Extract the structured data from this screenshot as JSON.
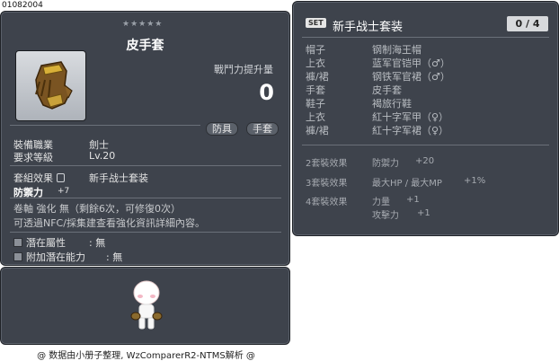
{
  "item_id": "01082004",
  "tooltip": {
    "stars": "★★★★★",
    "title": "皮手套",
    "attack_increase_label": "戰鬥力提升量",
    "attack_increase_value": "0",
    "tags": [
      "防具",
      "手套"
    ],
    "req_job_label": "裝備職業",
    "req_job_value": "劍士",
    "req_level_label": "要求等級",
    "req_level_value": "Lv.20",
    "set_effect_label": "套組效果",
    "set_effect_value": "新手战士套装",
    "stat_label": "防禦力",
    "stat_value": "+7",
    "upgrade_text": "卷軸 強化 無（剩餘6次，可修復0次）",
    "enhance_text": "可透過NFC/採集建查看強化資訊詳細內容。",
    "potential_label": "潛在屬性",
    "potential_value": ": 無",
    "additional_potential_label": "附加潛在能力",
    "additional_potential_value": ": 無"
  },
  "set_panel": {
    "badge": "SET",
    "name": "新手战士套装",
    "count": "0 / 4",
    "items": [
      {
        "slot": "帽子",
        "name": "钢制海王帽"
      },
      {
        "slot": "上衣",
        "name": "蓝军官铠甲（♂）"
      },
      {
        "slot": "褲/裙",
        "name": "钢铁军官裙（♂）"
      },
      {
        "slot": "手套",
        "name": "皮手套"
      },
      {
        "slot": "鞋子",
        "name": "褐旅行鞋"
      },
      {
        "slot": "上衣",
        "name": "紅十字军甲（♀）"
      },
      {
        "slot": "褲/裙",
        "name": "紅十字军裙（♀）"
      }
    ],
    "effects": [
      {
        "label": "2套裝效果",
        "lines": [
          {
            "stat": "防禦力",
            "value": "+20"
          }
        ]
      },
      {
        "label": "3套裝效果",
        "lines": [
          {
            "stat": "最大HP / 最大MP",
            "value": "+1%"
          }
        ]
      },
      {
        "label": "4套裝效果",
        "lines": [
          {
            "stat": "力量",
            "value": "+1"
          },
          {
            "stat": "攻擊力",
            "value": "+1"
          }
        ]
      }
    ]
  },
  "footer": "@ 数据由小册子整理, WzComparerR2-NTMS解析 @",
  "icons": {
    "item": "leather-glove-icon",
    "avatar": "character-avatar"
  }
}
